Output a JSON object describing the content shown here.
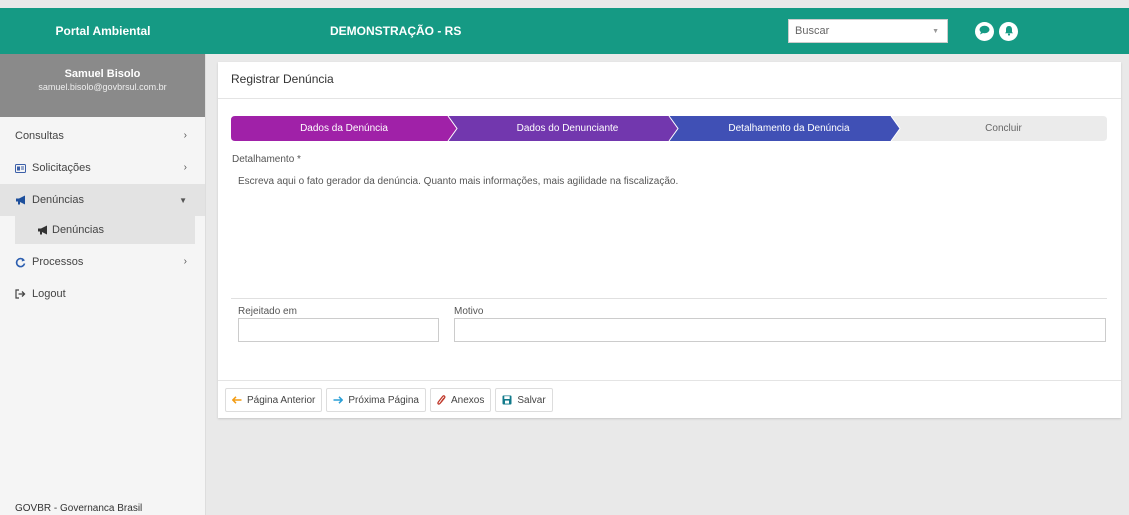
{
  "header": {
    "app_title": "Portal Ambiental",
    "org_title": "DEMONSTRAÇÃO - RS",
    "search_placeholder": "Buscar",
    "icons": [
      "chat-icon",
      "bell-icon"
    ]
  },
  "user": {
    "name": "Samuel Bisolo",
    "email": "samuel.bisolo@govbrsul.com.br"
  },
  "sidebar": {
    "items": [
      {
        "label": "Consultas",
        "icon": ""
      },
      {
        "label": "Solicitações",
        "icon": "id-card-icon"
      },
      {
        "label": "Denúncias",
        "icon": "megaphone-icon",
        "active": true
      },
      {
        "label": "Processos",
        "icon": "refresh-icon"
      },
      {
        "label": "Logout",
        "icon": "logout-icon"
      }
    ],
    "submenu_label": "Denúncias",
    "footer": "GOVBR - Governanca Brasil"
  },
  "form": {
    "title": "Registrar Denúncia",
    "steps": [
      {
        "label": "Dados da Denúncia",
        "color": "#a021a8"
      },
      {
        "label": "Dados do Denunciante",
        "color": "#7237ae"
      },
      {
        "label": "Detalhamento da Denúncia",
        "color": "#4050b5"
      },
      {
        "label": "Concluir",
        "color": "#ebebeb"
      }
    ],
    "detail_label": "Detalhamento *",
    "detail_placeholder": "Escreva aqui o fato gerador da denúncia. Quanto mais informações, mais agilidade na fiscalização.",
    "rejected_label": "Rejeitado em",
    "reason_label": "Motivo",
    "rejected_value": "",
    "reason_value": ""
  },
  "actions": {
    "prev": "Página Anterior",
    "next": "Próxima Página",
    "attachments": "Anexos",
    "save": "Salvar"
  },
  "colors": {
    "primary": "#159a84",
    "arrow_orange": "#f39c12",
    "arrow_blue": "#2a9fd6",
    "attach_red": "#c0392b",
    "save_teal": "#117a8b"
  }
}
